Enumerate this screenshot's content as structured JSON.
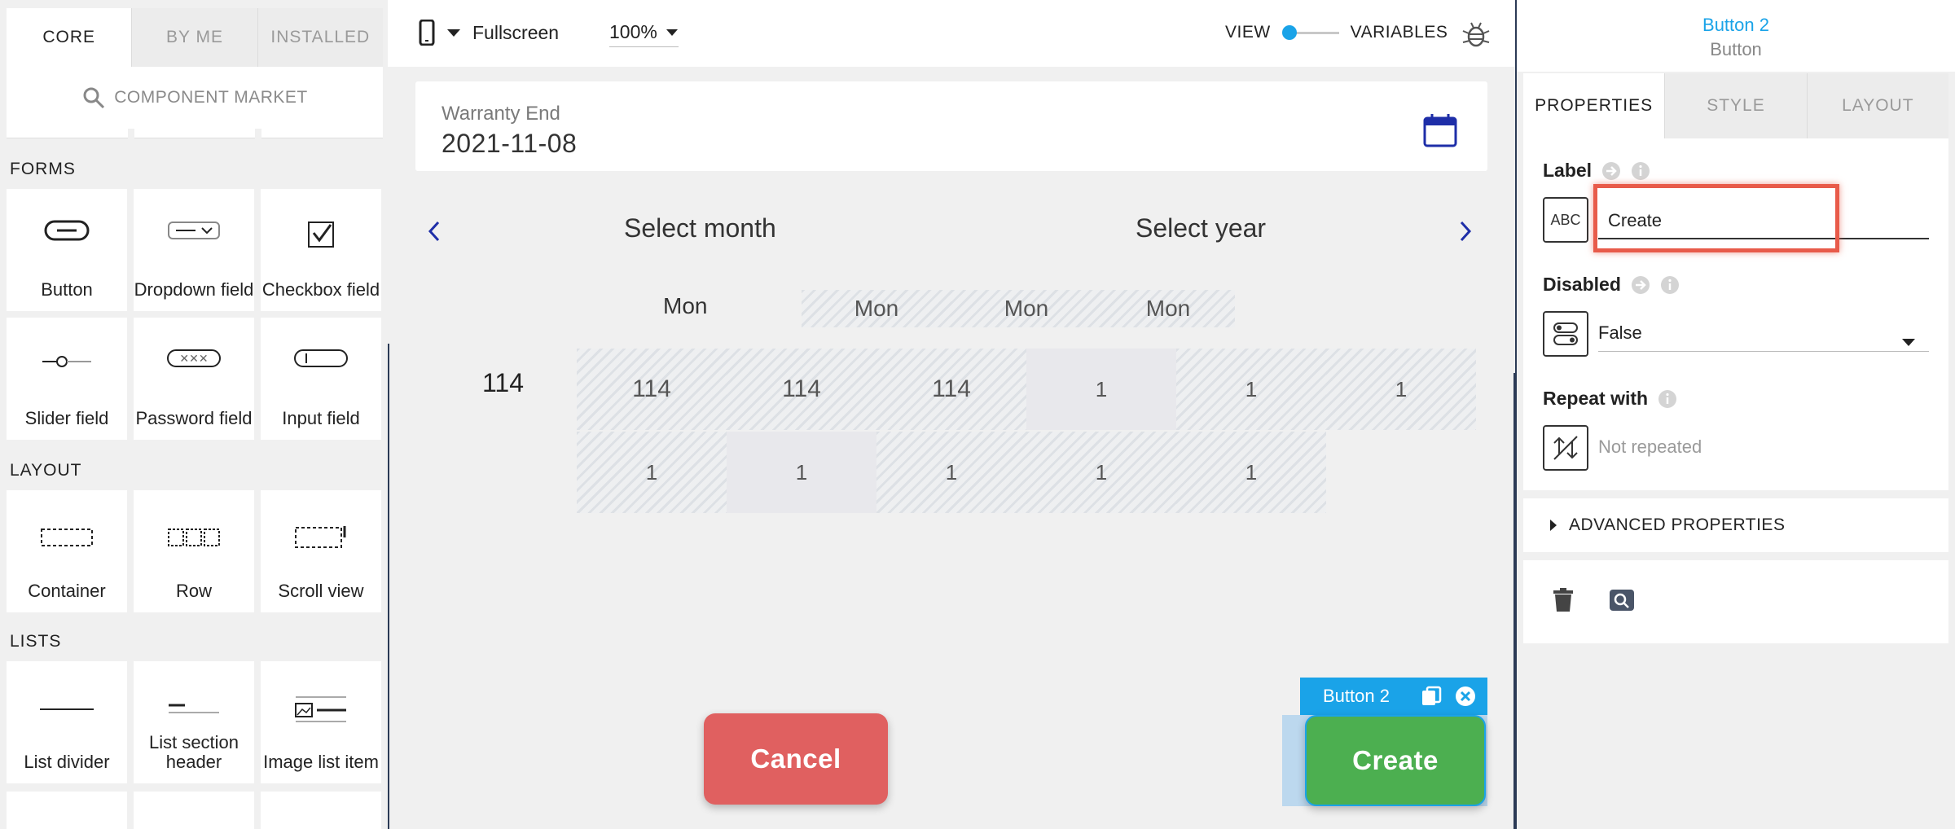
{
  "left_panel": {
    "tabs": [
      {
        "label": "CORE",
        "active": true
      },
      {
        "label": "BY ME",
        "active": false
      },
      {
        "label": "INSTALLED",
        "active": false
      }
    ],
    "market_label": "COMPONENT MARKET",
    "sections": {
      "forms": {
        "title": "FORMS",
        "items": [
          {
            "label": "Button",
            "icon": "button-icon"
          },
          {
            "label": "Dropdown field",
            "icon": "dropdown-icon"
          },
          {
            "label": "Checkbox field",
            "icon": "checkbox-icon"
          },
          {
            "label": "Slider field",
            "icon": "slider-icon"
          },
          {
            "label": "Password field",
            "icon": "password-icon"
          },
          {
            "label": "Input field",
            "icon": "input-icon"
          }
        ]
      },
      "layout": {
        "title": "LAYOUT",
        "items": [
          {
            "label": "Container",
            "icon": "container-icon"
          },
          {
            "label": "Row",
            "icon": "row-icon"
          },
          {
            "label": "Scroll view",
            "icon": "scroll-view-icon"
          }
        ]
      },
      "lists": {
        "title": "LISTS",
        "items": [
          {
            "label": "List divider",
            "icon": "list-divider-icon"
          },
          {
            "label": "List section header",
            "icon": "list-section-header-icon"
          },
          {
            "label": "Image list item",
            "icon": "image-list-item-icon"
          }
        ]
      }
    }
  },
  "toolbar": {
    "device": "Fullscreen",
    "zoom": "100%",
    "view_label": "VIEW",
    "variables_label": "VARIABLES"
  },
  "canvas": {
    "warranty": {
      "label": "Warranty End",
      "value": "2021-11-08"
    },
    "select_month": "Select month",
    "select_year": "Select year",
    "weekday_cells": [
      "Mon",
      "Mon",
      "Mon",
      "Mon"
    ],
    "first_number": "114",
    "row1_cells": [
      "114",
      "114",
      "114",
      "1",
      "1",
      "1"
    ],
    "row2_cells": [
      "1",
      "1",
      "1",
      "1",
      "1"
    ],
    "selected_chip": "Button 2",
    "buttons": {
      "cancel": "Cancel",
      "create": "Create"
    }
  },
  "right_panel": {
    "title": "Button 2",
    "subtitle": "Button",
    "tabs": [
      {
        "label": "PROPERTIES",
        "active": true
      },
      {
        "label": "STYLE",
        "active": false
      },
      {
        "label": "LAYOUT",
        "active": false
      }
    ],
    "label": {
      "title": "Label",
      "type_badge": "ABC",
      "value": "Create"
    },
    "disabled": {
      "title": "Disabled",
      "value": "False"
    },
    "repeat": {
      "title": "Repeat with",
      "value": "Not repeated"
    },
    "advanced": "ADVANCED PROPERTIES"
  },
  "colors": {
    "accent": "#1aa3e8",
    "cancel": "#e06060",
    "create": "#4caf50",
    "highlight": "#e85b4a",
    "nav": "#1e2ea8"
  }
}
